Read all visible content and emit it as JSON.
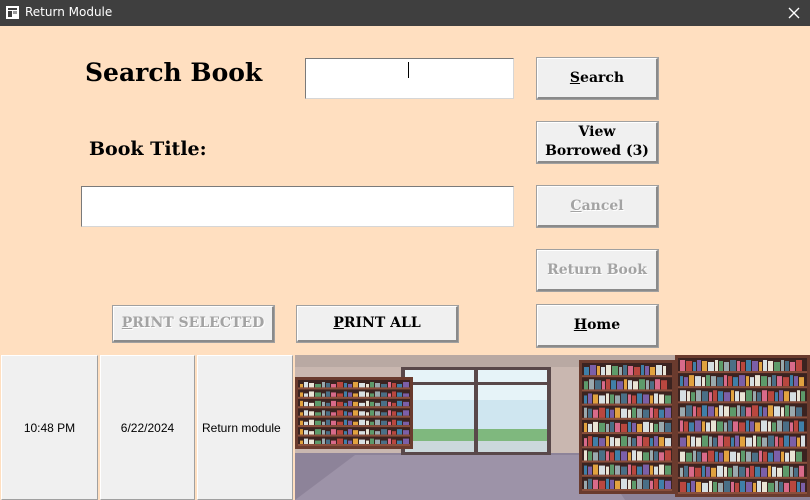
{
  "window": {
    "title": "Return Module",
    "close_symbol": "×"
  },
  "form": {
    "heading": "Search Book",
    "book_title_label": "Book Title:",
    "search_value": "",
    "book_title_value": ""
  },
  "buttons": {
    "search": {
      "underline": "S",
      "rest": "earch"
    },
    "view_borrowed": {
      "line1": "View",
      "line2": "Borrowed (3)"
    },
    "cancel": {
      "underline": "C",
      "rest": "ancel"
    },
    "return_book": "Return Book",
    "home": {
      "underline": "H",
      "rest": "ome"
    },
    "print_selected": {
      "underline": "P",
      "rest": "RINT SELECTED"
    },
    "print_all": {
      "underline": "P",
      "rest": "RINT ALL"
    }
  },
  "button_state": {
    "cancel_enabled": false,
    "return_book_enabled": false,
    "print_selected_enabled": false
  },
  "status_bar": {
    "time": "10:48 PM",
    "date": "6/22/2024",
    "module": "Return module"
  },
  "icons": {
    "app": "app-form-icon",
    "close": "close-icon",
    "picture": "library-bookshelves-illustration"
  },
  "colors": {
    "form_background": "#ffdfc0",
    "titlebar": "#3f3f3f",
    "button_face": "#f0f0f0",
    "disabled_text": "#a3a3a3"
  }
}
